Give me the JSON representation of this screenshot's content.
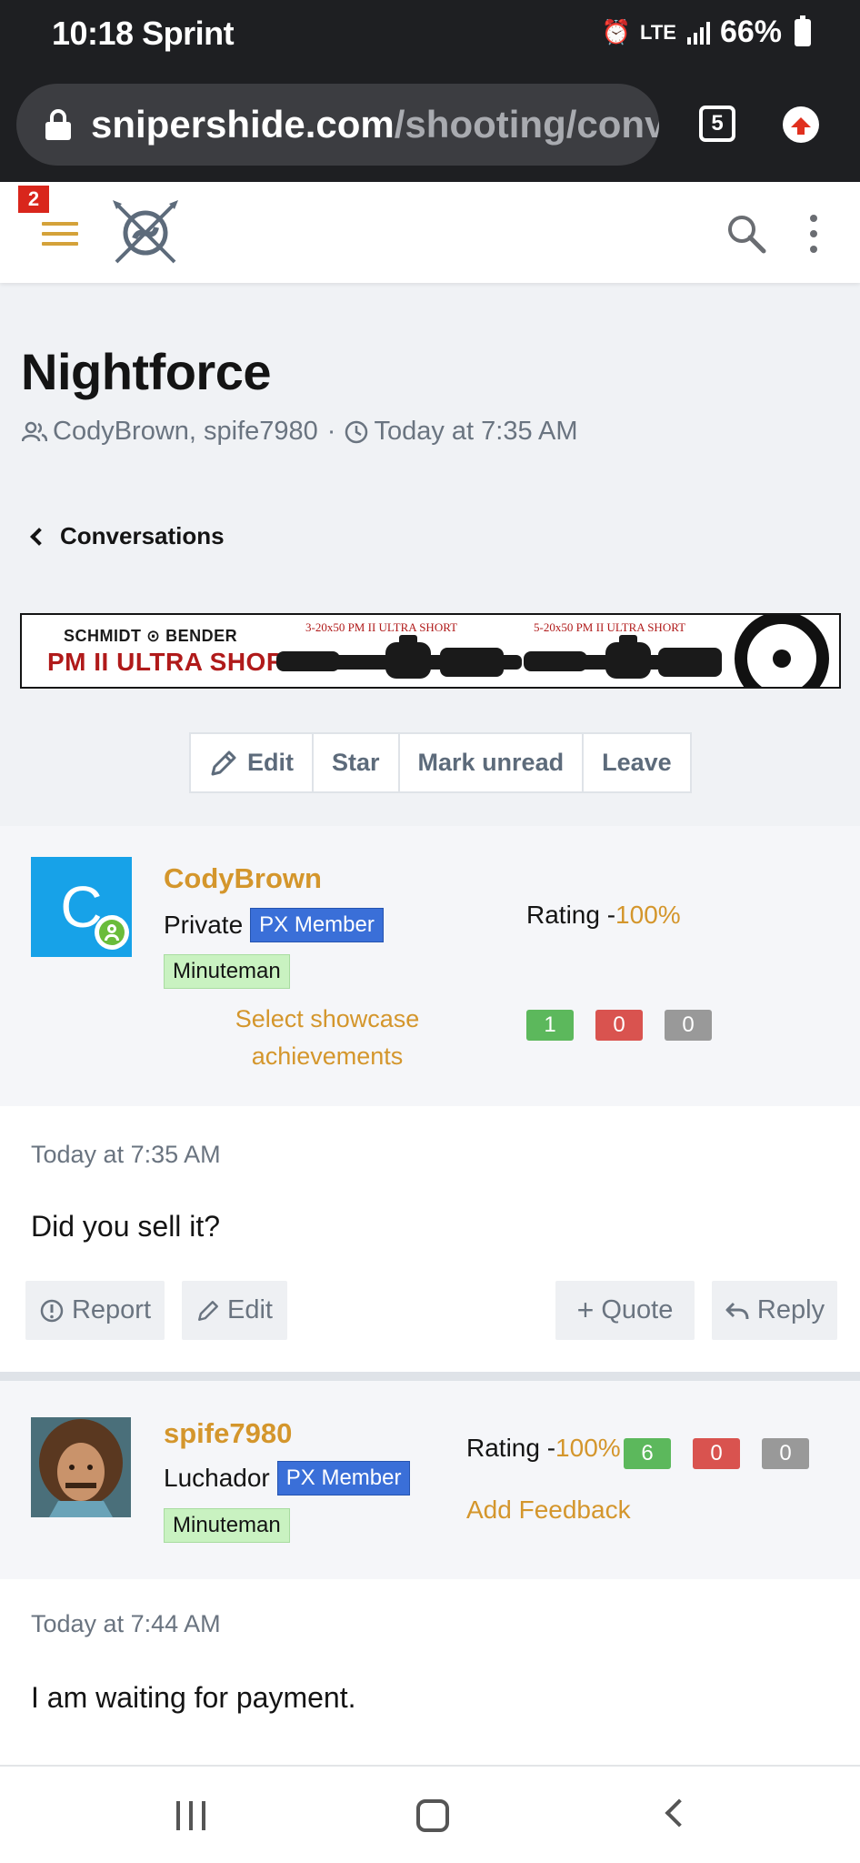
{
  "status_bar": {
    "time_carrier": "10:18 Sprint",
    "network": "LTE",
    "battery": "66%"
  },
  "browser": {
    "url_host": "snipershide.com",
    "url_path": "/shooting/conv",
    "tab_count": "5"
  },
  "header": {
    "notification_count": "2"
  },
  "thread": {
    "title": "Nightforce",
    "participants": "CodyBrown, spife7980",
    "separator": "·",
    "started": "Today at 7:35 AM",
    "back_label": "Conversations"
  },
  "banner": {
    "brand": "SCHMIDT ⊙ BENDER",
    "product": "PM II ULTRA SHORT",
    "scope1_label": "3-20x50 PM II ULTRA SHORT",
    "scope2_label": "5-20x50 PM II ULTRA SHORT"
  },
  "actions": {
    "edit": "Edit",
    "star": "Star",
    "mark_unread": "Mark unread",
    "leave": "Leave"
  },
  "messages": [
    {
      "username": "CodyBrown",
      "avatar_letter": "C",
      "rank": "Private",
      "px_badge": "PX Member",
      "group_badge": "Minuteman",
      "showcase": "Select showcase achievements",
      "rating_label": "Rating -",
      "rating_pct": "100%",
      "feedback": {
        "positive": "1",
        "negative": "0",
        "neutral": "0"
      },
      "time": "Today at 7:35 AM",
      "text": "Did you sell it?",
      "buttons": {
        "report": "Report",
        "edit": "Edit",
        "quote": "Quote",
        "reply": "Reply"
      }
    },
    {
      "username": "spife7980",
      "rank": "Luchador",
      "px_badge": "PX Member",
      "group_badge": "Minuteman",
      "rating_label": "Rating -",
      "rating_pct": "100%",
      "feedback": {
        "positive": "6",
        "negative": "0",
        "neutral": "0"
      },
      "add_feedback": "Add Feedback",
      "time": "Today at 7:44 AM",
      "text": "I am waiting for payment."
    }
  ],
  "colors": {
    "accent_gold": "#d4962c",
    "px_blue": "#3a6fd8",
    "badge_green": "#c9f2c1",
    "avatar_blue": "#17a2e8"
  }
}
